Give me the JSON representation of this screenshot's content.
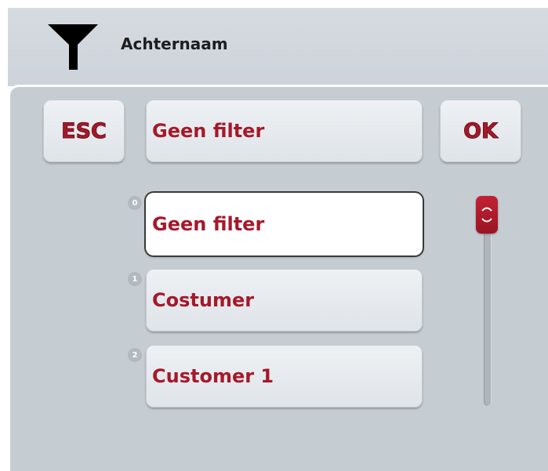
{
  "header": {
    "icon": "filter-funnel-icon",
    "title": "Achternaam"
  },
  "toolbar": {
    "esc_label": "ESC",
    "current_filter": "Geen filter",
    "ok_label": "OK"
  },
  "list": {
    "items": [
      {
        "index": "0",
        "label": "Geen filter",
        "selected": true
      },
      {
        "index": "1",
        "label": "Costumer",
        "selected": false
      },
      {
        "index": "2",
        "label": "Customer 1",
        "selected": false
      }
    ]
  },
  "colors": {
    "accent": "#a5192a",
    "panel": "#c5cdd3",
    "header": "#d6dbe1"
  }
}
